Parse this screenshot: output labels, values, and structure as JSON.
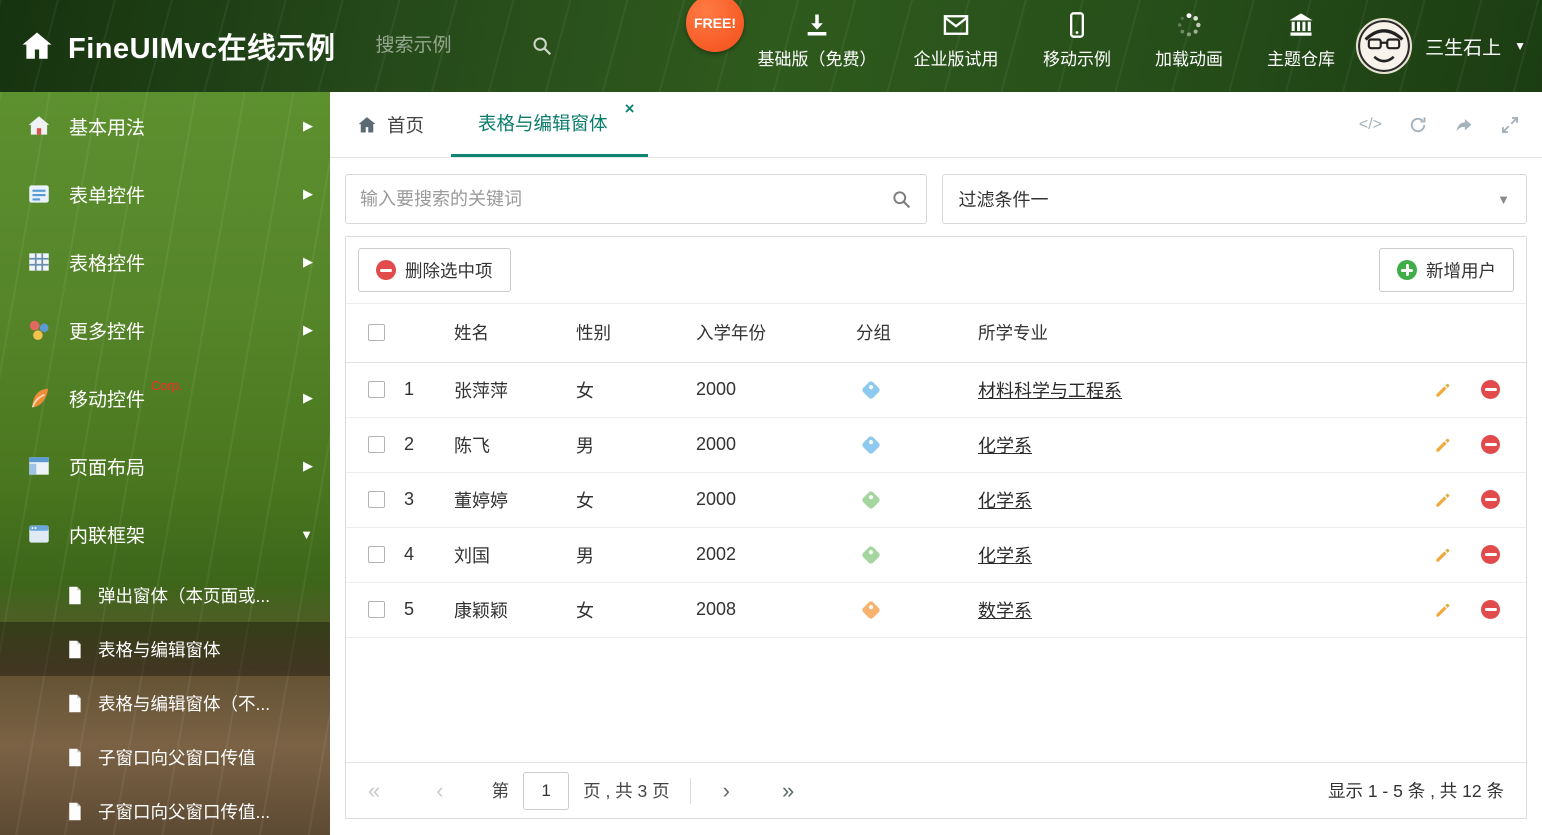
{
  "header": {
    "title": "FineUIMvc在线示例",
    "search_placeholder": "搜索示例",
    "free_badge": "FREE!",
    "nav_items": [
      {
        "label": "基础版（免费）",
        "icon": "download-icon"
      },
      {
        "label": "企业版试用",
        "icon": "envelope-icon"
      },
      {
        "label": "移动示例",
        "icon": "mobile-icon"
      },
      {
        "label": "加载动画",
        "icon": "spinner-icon"
      },
      {
        "label": "主题仓库",
        "icon": "bank-icon"
      }
    ],
    "user_name": "三生石上"
  },
  "sidebar": {
    "items": [
      {
        "label": "基本用法",
        "icon": "home-icon"
      },
      {
        "label": "表单控件",
        "icon": "form-icon"
      },
      {
        "label": "表格控件",
        "icon": "table-icon"
      },
      {
        "label": "更多控件",
        "icon": "widgets-icon"
      },
      {
        "label": "移动控件",
        "icon": "mobile-control-icon",
        "badge": "Corp."
      },
      {
        "label": "页面布局",
        "icon": "layout-icon"
      },
      {
        "label": "内联框架",
        "icon": "iframe-icon"
      }
    ],
    "subitems": [
      {
        "label": "弹出窗体（本页面或...",
        "selected": false
      },
      {
        "label": "表格与编辑窗体",
        "selected": true
      },
      {
        "label": "表格与编辑窗体（不...",
        "selected": false
      },
      {
        "label": "子窗口向父窗口传值",
        "selected": false
      },
      {
        "label": "子窗口向父窗口传值...",
        "selected": false
      }
    ]
  },
  "tabs": {
    "home_label": "首页",
    "active_label": "表格与编辑窗体"
  },
  "filter": {
    "search_placeholder": "输入要搜索的关键词",
    "dropdown_value": "过滤条件一"
  },
  "toolbar": {
    "delete_label": "删除选中项",
    "add_label": "新增用户"
  },
  "table": {
    "columns": [
      "姓名",
      "性别",
      "入学年份",
      "分组",
      "所学专业"
    ],
    "rows": [
      {
        "num": "1",
        "name": "张萍萍",
        "gender": "女",
        "year": "2000",
        "tag_color": "#8ec9ef",
        "major": "材料科学与工程系"
      },
      {
        "num": "2",
        "name": "陈飞",
        "gender": "男",
        "year": "2000",
        "tag_color": "#8ec9ef",
        "major": "化学系"
      },
      {
        "num": "3",
        "name": "董婷婷",
        "gender": "女",
        "year": "2000",
        "tag_color": "#a5d6a0",
        "major": "化学系"
      },
      {
        "num": "4",
        "name": "刘国",
        "gender": "男",
        "year": "2002",
        "tag_color": "#a5d6a0",
        "major": "化学系"
      },
      {
        "num": "5",
        "name": "康颖颖",
        "gender": "女",
        "year": "2008",
        "tag_color": "#f6b26f",
        "major": "数学系"
      }
    ]
  },
  "pagination": {
    "label_page_prefix": "第",
    "current_page": "1",
    "label_page_suffix": "页 , 共 3 页",
    "summary": "显示 1 - 5 条 , 共 12 条"
  },
  "icons": {
    "chevron_right": "▶",
    "chevron_down": "▼",
    "caret_down": "▼",
    "close_tab": "×",
    "code": "</>",
    "pager_first": "«",
    "pager_prev": "‹",
    "pager_next": "›",
    "pager_last": "»"
  },
  "colors": {
    "theme": "#0f8674",
    "danger": "#e14b4b",
    "success": "#3fae49",
    "tag_blue": "#8ec9ef",
    "tag_green": "#a5d6a0",
    "tag_orange": "#f6b26f"
  }
}
